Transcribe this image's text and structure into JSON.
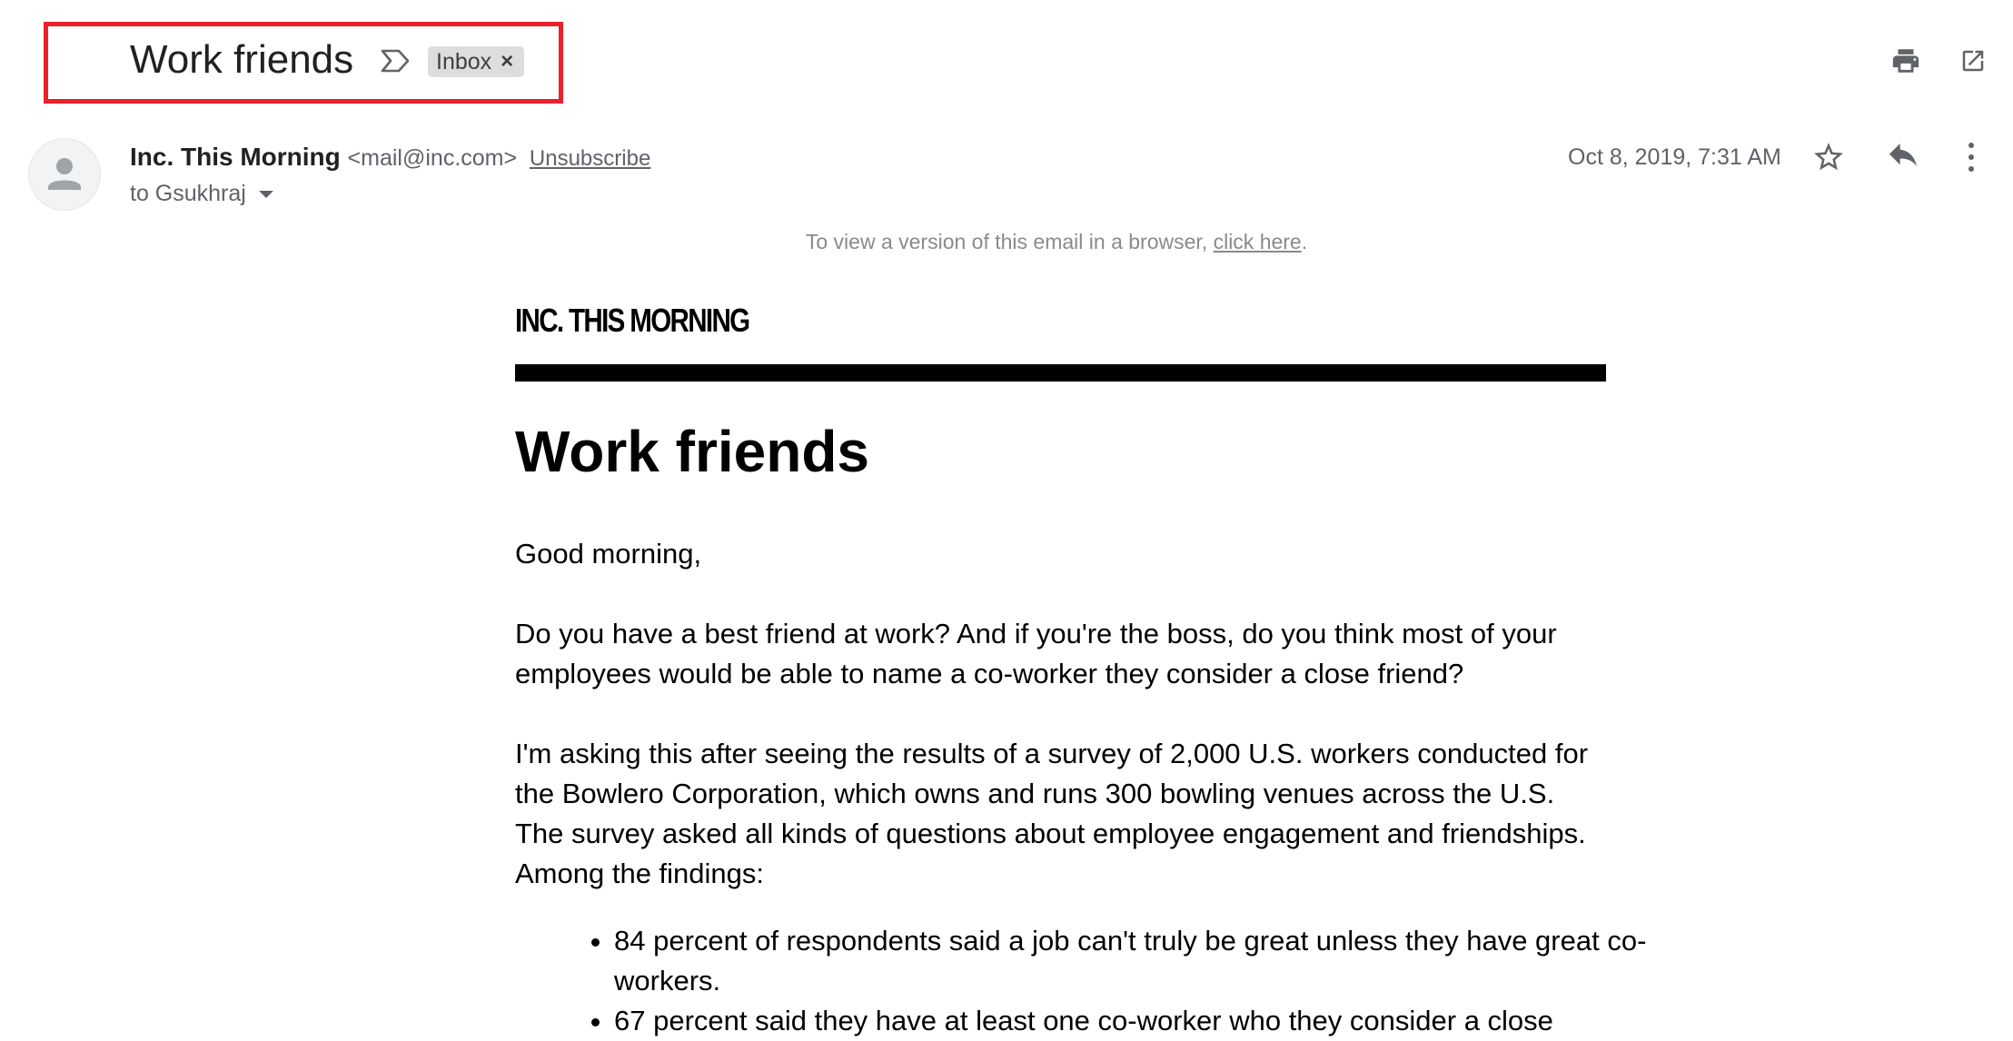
{
  "header": {
    "subject": "Work friends",
    "label": "Inbox",
    "label_remove": "×",
    "important_icon": "importance-marker-icon",
    "print_icon": "print-icon",
    "popout_icon": "open-in-new-window-icon"
  },
  "message": {
    "sender_name": "Inc. This Morning",
    "sender_email": "<mail@inc.com>",
    "unsubscribe": "Unsubscribe",
    "to": "to Gsukhraj",
    "date": "Oct 8, 2019, 7:31 AM",
    "star_icon": "star-icon",
    "reply_icon": "reply-icon",
    "more_icon": "more-vertical-icon"
  },
  "email_body": {
    "browser_note": "To view a version of this email in a browser,",
    "browser_link": "click here",
    "browser_note_end": ".",
    "masthead": "INC. THIS MORNING",
    "headline": "Work friends",
    "greeting": "Good morning,",
    "paragraph_1": "Do you have a best friend at work? And if you're the boss, do you think most of your employees would be able to name a co-worker they consider a close friend?",
    "paragraph_2": "I'm asking this after seeing the results of a survey of 2,000 U.S. workers conducted for the Bowlero Corporation, which owns and runs 300 bowling venues across the U.S. The survey asked all kinds of questions about employee engagement and friendships. Among the findings:",
    "bullets": [
      "84 percent of respondents said a job can't truly be great unless they have great co-workers.",
      "67 percent said they have at least one co-worker who they consider a close"
    ]
  },
  "colors": {
    "highlight": "#e8212a",
    "chip_bg": "#dddddd",
    "meta_text": "#5f6368"
  }
}
